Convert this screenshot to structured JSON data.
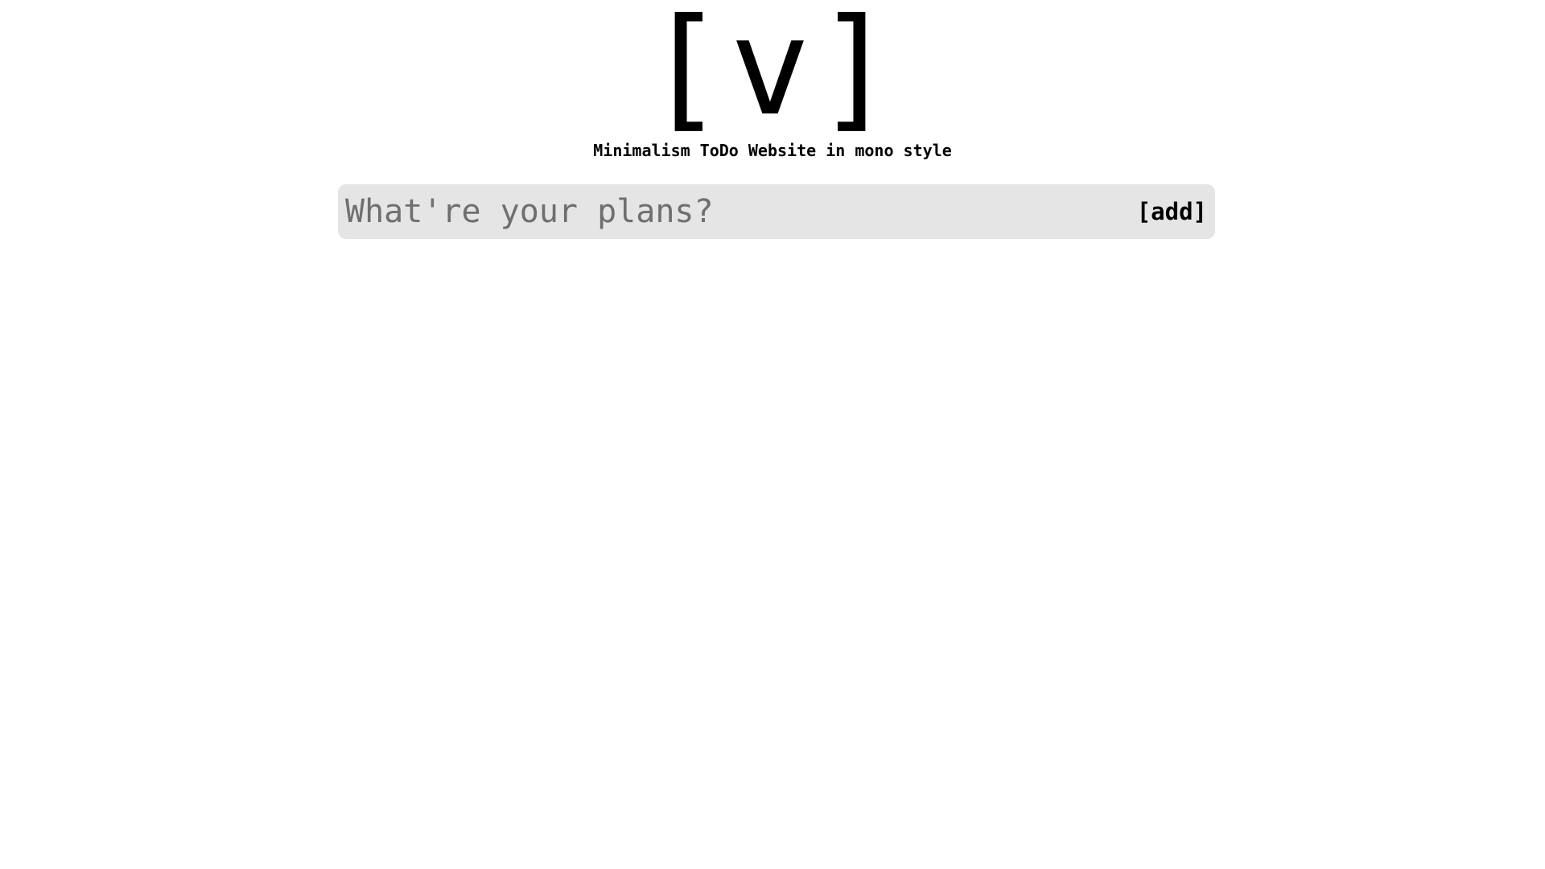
{
  "header": {
    "logo": "[v]",
    "tagline": "Minimalism ToDo Website in mono style"
  },
  "new_task": {
    "placeholder": "What're your plans?",
    "value": "",
    "add_label": "[add]"
  },
  "colors": {
    "background": "#ffffff",
    "input_background": "#e5e5e5",
    "placeholder": "#6f6f6f",
    "text": "#000000"
  }
}
